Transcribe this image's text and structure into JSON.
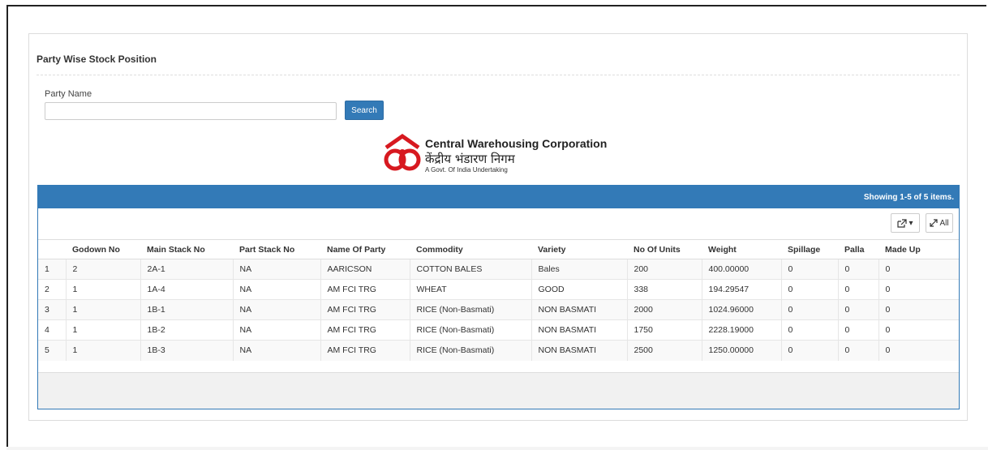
{
  "panel": {
    "title": "Party Wise Stock Position"
  },
  "search": {
    "label": "Party Name",
    "value": "",
    "placeholder": "",
    "button_label": "Search"
  },
  "logo": {
    "english": "Central Warehousing Corporation",
    "hindi": "केंद्रीय भंडारण निगम",
    "tagline": "A Govt. Of India Undertaking",
    "color": "#d71920"
  },
  "grid": {
    "summary": "Showing 1-5 of 5 items.",
    "header_color": "#337ab7",
    "toolbar": {
      "export_icon": "export-icon",
      "export_caret": "▾",
      "all_icon": "expand-icon",
      "all_label": "All"
    },
    "columns": [
      "",
      "Godown No",
      "Main Stack No",
      "Part Stack No",
      "Name Of Party",
      "Commodity",
      "Variety",
      "No Of Units",
      "Weight",
      "Spillage",
      "Palla",
      "Made Up"
    ],
    "rows": [
      [
        "1",
        "2",
        "2A-1",
        "NA",
        "AARICSON",
        "COTTON BALES",
        "Bales",
        "200",
        "400.00000",
        "0",
        "0",
        "0"
      ],
      [
        "2",
        "1",
        "1A-4",
        "NA",
        "AM FCI TRG",
        "WHEAT",
        "GOOD",
        "338",
        "194.29547",
        "0",
        "0",
        "0"
      ],
      [
        "3",
        "1",
        "1B-1",
        "NA",
        "AM FCI TRG",
        "RICE (Non-Basmati)",
        "NON BASMATI",
        "2000",
        "1024.96000",
        "0",
        "0",
        "0"
      ],
      [
        "4",
        "1",
        "1B-2",
        "NA",
        "AM FCI TRG",
        "RICE (Non-Basmati)",
        "NON BASMATI",
        "1750",
        "2228.19000",
        "0",
        "0",
        "0"
      ],
      [
        "5",
        "1",
        "1B-3",
        "NA",
        "AM FCI TRG",
        "RICE (Non-Basmati)",
        "NON BASMATI",
        "2500",
        "1250.00000",
        "0",
        "0",
        "0"
      ]
    ]
  }
}
